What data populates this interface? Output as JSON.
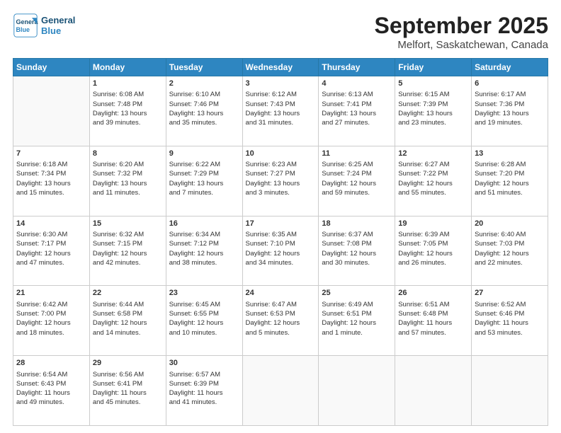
{
  "logo": {
    "line1": "General",
    "line2": "Blue"
  },
  "title": "September 2025",
  "location": "Melfort, Saskatchewan, Canada",
  "days_of_week": [
    "Sunday",
    "Monday",
    "Tuesday",
    "Wednesday",
    "Thursday",
    "Friday",
    "Saturday"
  ],
  "weeks": [
    [
      {
        "num": "",
        "info": ""
      },
      {
        "num": "1",
        "info": "Sunrise: 6:08 AM\nSunset: 7:48 PM\nDaylight: 13 hours\nand 39 minutes."
      },
      {
        "num": "2",
        "info": "Sunrise: 6:10 AM\nSunset: 7:46 PM\nDaylight: 13 hours\nand 35 minutes."
      },
      {
        "num": "3",
        "info": "Sunrise: 6:12 AM\nSunset: 7:43 PM\nDaylight: 13 hours\nand 31 minutes."
      },
      {
        "num": "4",
        "info": "Sunrise: 6:13 AM\nSunset: 7:41 PM\nDaylight: 13 hours\nand 27 minutes."
      },
      {
        "num": "5",
        "info": "Sunrise: 6:15 AM\nSunset: 7:39 PM\nDaylight: 13 hours\nand 23 minutes."
      },
      {
        "num": "6",
        "info": "Sunrise: 6:17 AM\nSunset: 7:36 PM\nDaylight: 13 hours\nand 19 minutes."
      }
    ],
    [
      {
        "num": "7",
        "info": "Sunrise: 6:18 AM\nSunset: 7:34 PM\nDaylight: 13 hours\nand 15 minutes."
      },
      {
        "num": "8",
        "info": "Sunrise: 6:20 AM\nSunset: 7:32 PM\nDaylight: 13 hours\nand 11 minutes."
      },
      {
        "num": "9",
        "info": "Sunrise: 6:22 AM\nSunset: 7:29 PM\nDaylight: 13 hours\nand 7 minutes."
      },
      {
        "num": "10",
        "info": "Sunrise: 6:23 AM\nSunset: 7:27 PM\nDaylight: 13 hours\nand 3 minutes."
      },
      {
        "num": "11",
        "info": "Sunrise: 6:25 AM\nSunset: 7:24 PM\nDaylight: 12 hours\nand 59 minutes."
      },
      {
        "num": "12",
        "info": "Sunrise: 6:27 AM\nSunset: 7:22 PM\nDaylight: 12 hours\nand 55 minutes."
      },
      {
        "num": "13",
        "info": "Sunrise: 6:28 AM\nSunset: 7:20 PM\nDaylight: 12 hours\nand 51 minutes."
      }
    ],
    [
      {
        "num": "14",
        "info": "Sunrise: 6:30 AM\nSunset: 7:17 PM\nDaylight: 12 hours\nand 47 minutes."
      },
      {
        "num": "15",
        "info": "Sunrise: 6:32 AM\nSunset: 7:15 PM\nDaylight: 12 hours\nand 42 minutes."
      },
      {
        "num": "16",
        "info": "Sunrise: 6:34 AM\nSunset: 7:12 PM\nDaylight: 12 hours\nand 38 minutes."
      },
      {
        "num": "17",
        "info": "Sunrise: 6:35 AM\nSunset: 7:10 PM\nDaylight: 12 hours\nand 34 minutes."
      },
      {
        "num": "18",
        "info": "Sunrise: 6:37 AM\nSunset: 7:08 PM\nDaylight: 12 hours\nand 30 minutes."
      },
      {
        "num": "19",
        "info": "Sunrise: 6:39 AM\nSunset: 7:05 PM\nDaylight: 12 hours\nand 26 minutes."
      },
      {
        "num": "20",
        "info": "Sunrise: 6:40 AM\nSunset: 7:03 PM\nDaylight: 12 hours\nand 22 minutes."
      }
    ],
    [
      {
        "num": "21",
        "info": "Sunrise: 6:42 AM\nSunset: 7:00 PM\nDaylight: 12 hours\nand 18 minutes."
      },
      {
        "num": "22",
        "info": "Sunrise: 6:44 AM\nSunset: 6:58 PM\nDaylight: 12 hours\nand 14 minutes."
      },
      {
        "num": "23",
        "info": "Sunrise: 6:45 AM\nSunset: 6:55 PM\nDaylight: 12 hours\nand 10 minutes."
      },
      {
        "num": "24",
        "info": "Sunrise: 6:47 AM\nSunset: 6:53 PM\nDaylight: 12 hours\nand 5 minutes."
      },
      {
        "num": "25",
        "info": "Sunrise: 6:49 AM\nSunset: 6:51 PM\nDaylight: 12 hours\nand 1 minute."
      },
      {
        "num": "26",
        "info": "Sunrise: 6:51 AM\nSunset: 6:48 PM\nDaylight: 11 hours\nand 57 minutes."
      },
      {
        "num": "27",
        "info": "Sunrise: 6:52 AM\nSunset: 6:46 PM\nDaylight: 11 hours\nand 53 minutes."
      }
    ],
    [
      {
        "num": "28",
        "info": "Sunrise: 6:54 AM\nSunset: 6:43 PM\nDaylight: 11 hours\nand 49 minutes."
      },
      {
        "num": "29",
        "info": "Sunrise: 6:56 AM\nSunset: 6:41 PM\nDaylight: 11 hours\nand 45 minutes."
      },
      {
        "num": "30",
        "info": "Sunrise: 6:57 AM\nSunset: 6:39 PM\nDaylight: 11 hours\nand 41 minutes."
      },
      {
        "num": "",
        "info": ""
      },
      {
        "num": "",
        "info": ""
      },
      {
        "num": "",
        "info": ""
      },
      {
        "num": "",
        "info": ""
      }
    ]
  ]
}
